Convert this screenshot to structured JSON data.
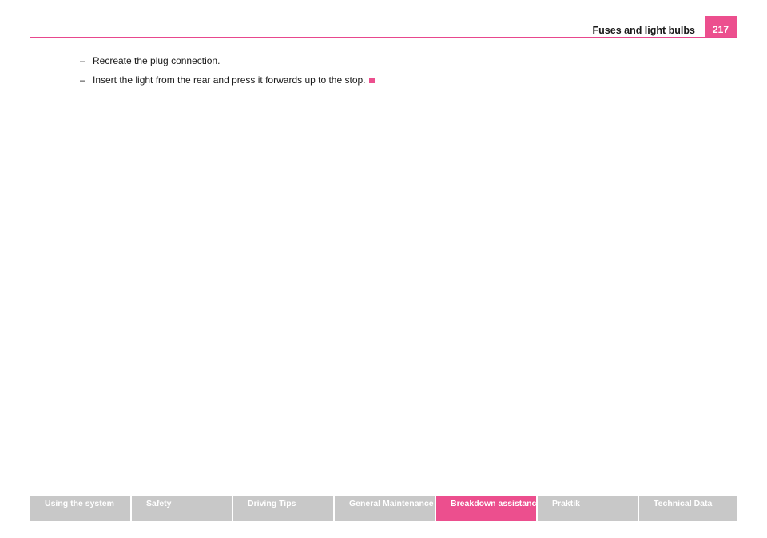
{
  "header": {
    "title": "Fuses and light bulbs",
    "page_number": "217"
  },
  "steps": [
    "Recreate the plug connection.",
    "Insert the light from the rear and press it forwards up to the stop."
  ],
  "step_marker": "–",
  "end_mark_icon": "pink-square-icon",
  "colors": {
    "accent": "#ec4f8e",
    "tab_inactive": "#c8c8c8",
    "tab_text": "#ffffff"
  },
  "footer": {
    "tabs": [
      {
        "label": "Using the system",
        "active": false
      },
      {
        "label": "Safety",
        "active": false
      },
      {
        "label": "Driving Tips",
        "active": false
      },
      {
        "label": "General Maintenance",
        "active": false
      },
      {
        "label": "Breakdown assistance",
        "active": true
      },
      {
        "label": "Praktik",
        "active": false
      },
      {
        "label": "Technical Data",
        "active": false
      }
    ]
  }
}
